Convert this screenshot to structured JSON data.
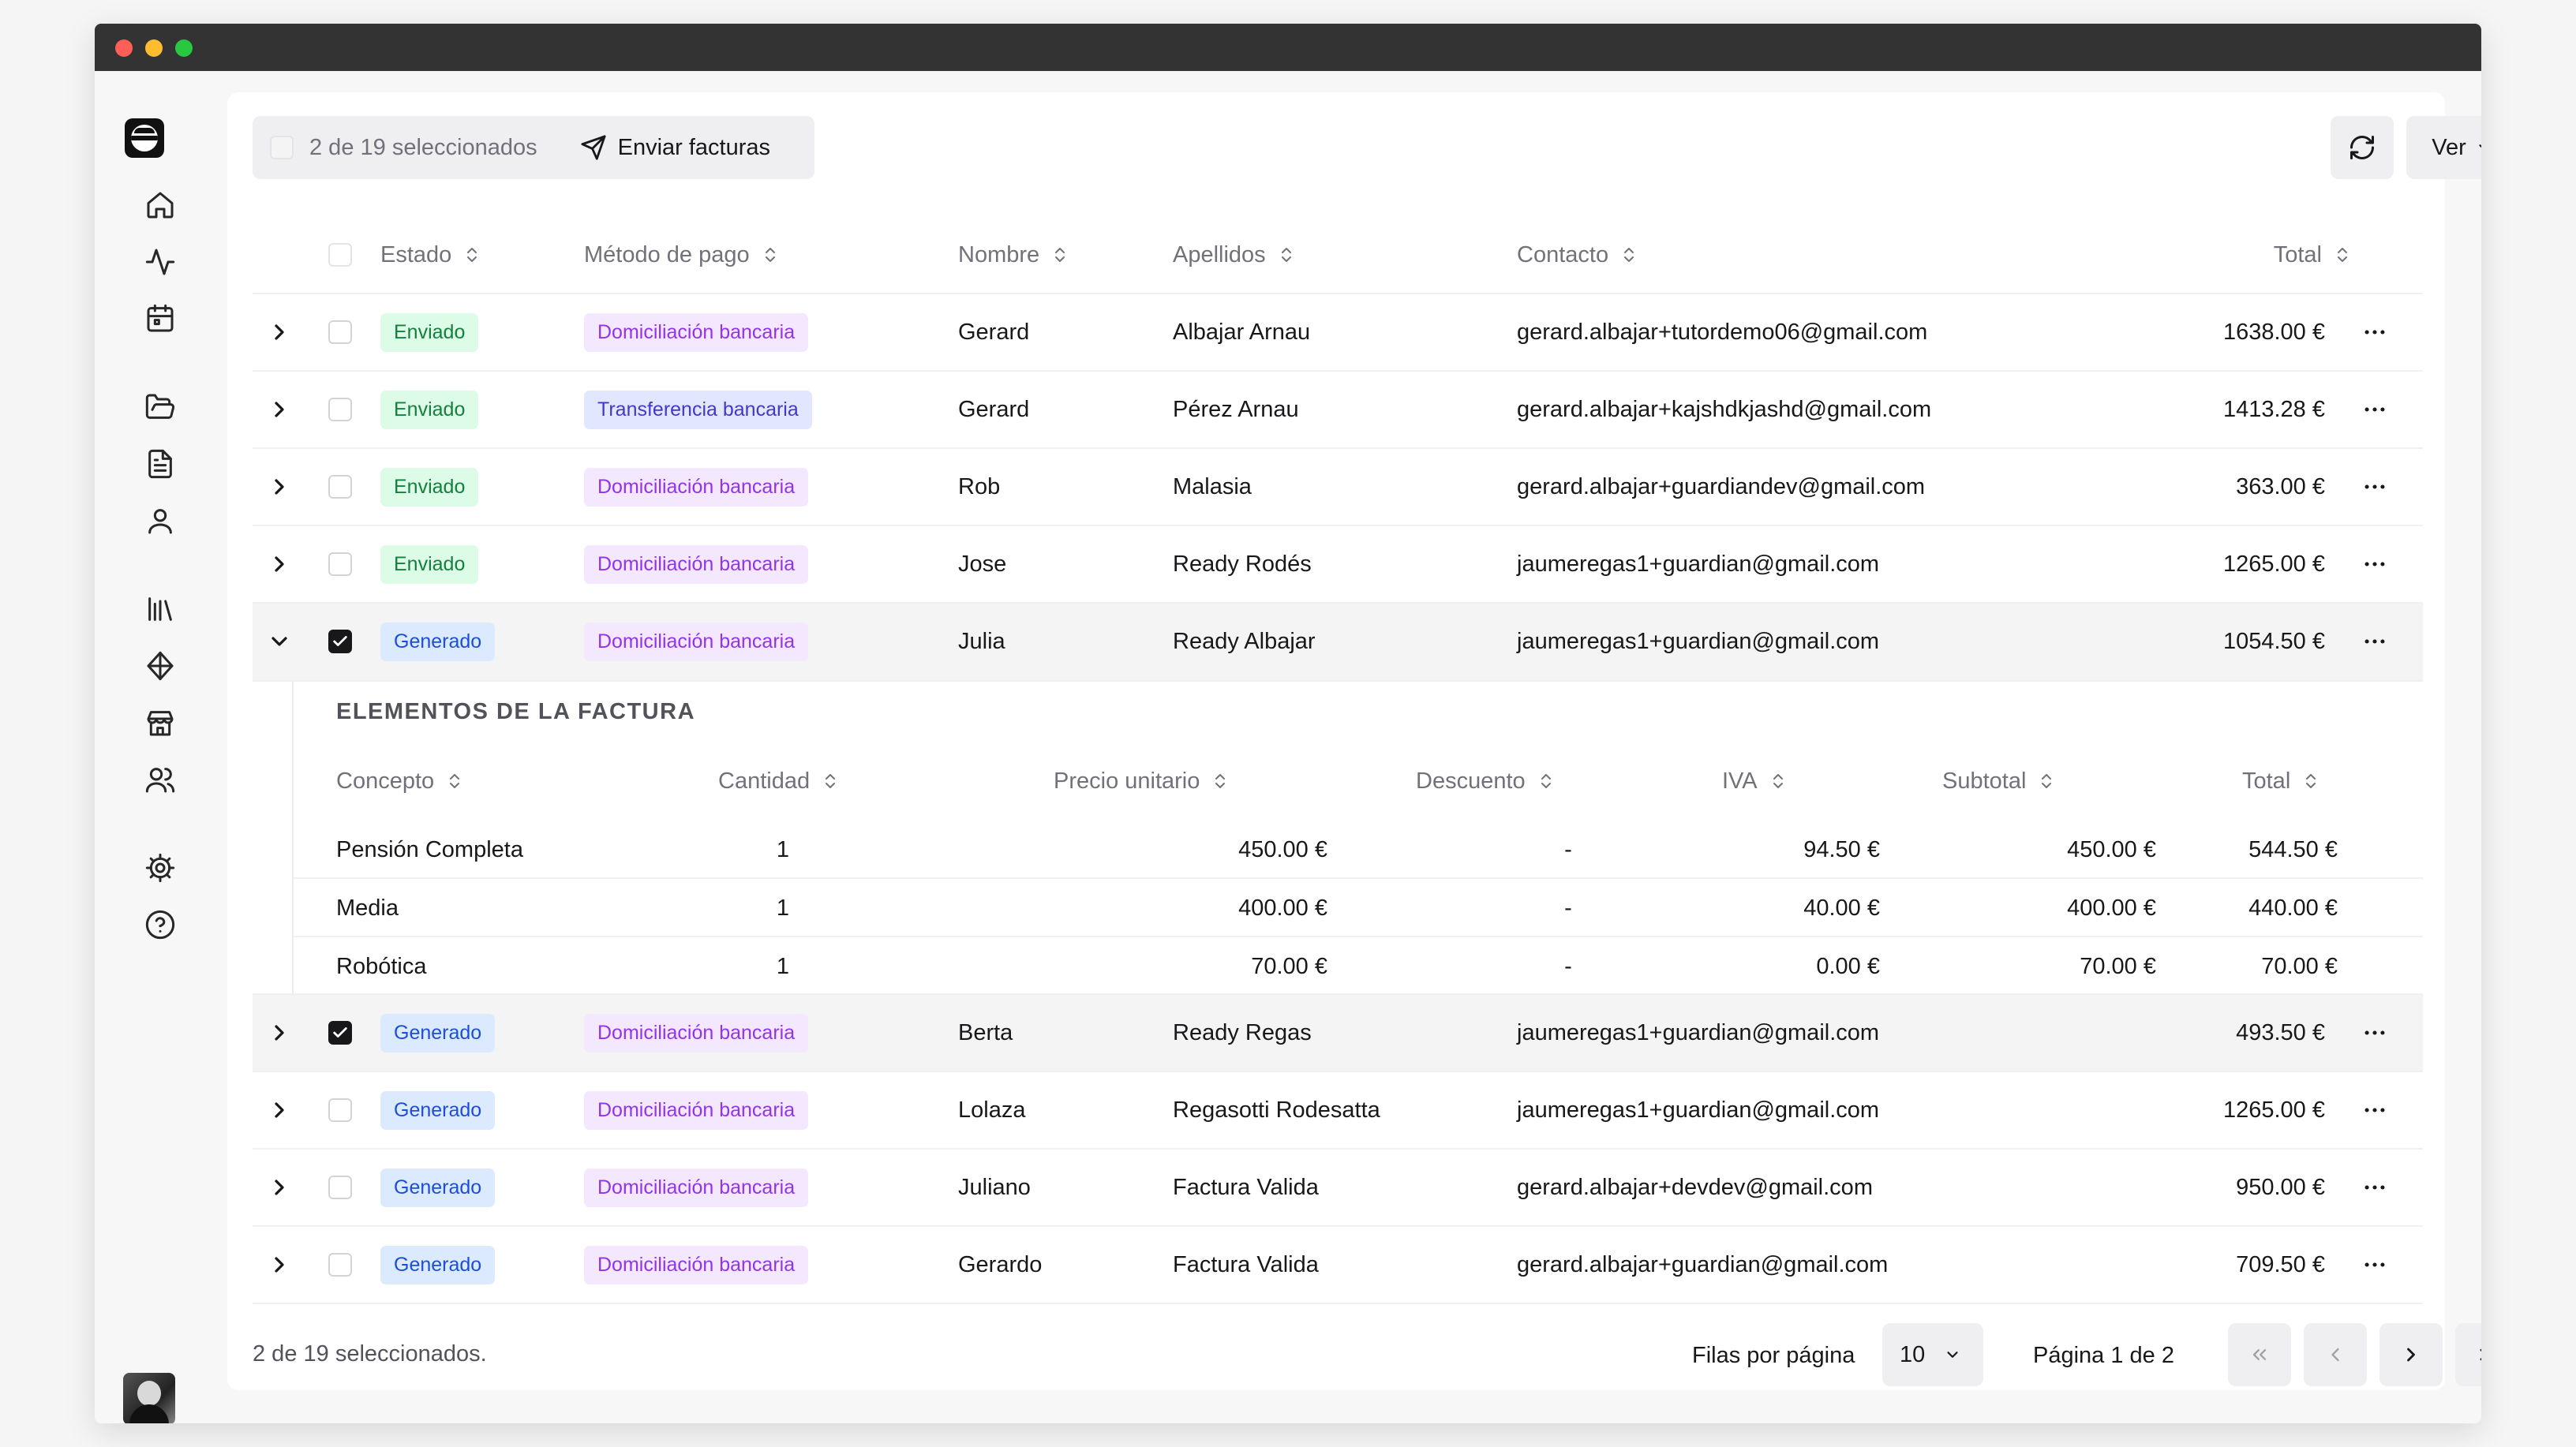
{
  "toolbar": {
    "selection_count": "2 de 19 seleccionados",
    "send_label": "Enviar facturas",
    "view_label": "Ver"
  },
  "table": {
    "headers": {
      "status": "Estado",
      "payment_method": "Método de pago",
      "name": "Nombre",
      "surname": "Apellidos",
      "contact": "Contacto",
      "total": "Total"
    },
    "rows": [
      {
        "status": "Enviado",
        "payment": "Domiciliación bancaria",
        "name": "Gerard",
        "surname": "Albajar Arnau",
        "contact": "gerard.albajar+tutordemo06@gmail.com",
        "total": "1638.00 €"
      },
      {
        "status": "Enviado",
        "payment": "Transferencia bancaria",
        "name": "Gerard",
        "surname": "Pérez Arnau",
        "contact": "gerard.albajar+kajshdkjashd@gmail.com",
        "total": "1413.28 €"
      },
      {
        "status": "Enviado",
        "payment": "Domiciliación bancaria",
        "name": "Rob",
        "surname": "Malasia",
        "contact": "gerard.albajar+guardiandev@gmail.com",
        "total": "363.00 €"
      },
      {
        "status": "Enviado",
        "payment": "Domiciliación bancaria",
        "name": "Jose",
        "surname": "Ready Rodés",
        "contact": "jaumeregas1+guardian@gmail.com",
        "total": "1265.00 €"
      },
      {
        "status": "Generado",
        "payment": "Domiciliación bancaria",
        "name": "Julia",
        "surname": "Ready Albajar",
        "contact": "jaumeregas1+guardian@gmail.com",
        "total": "1054.50 €"
      },
      {
        "status": "Generado",
        "payment": "Domiciliación bancaria",
        "name": "Berta",
        "surname": "Ready Regas",
        "contact": "jaumeregas1+guardian@gmail.com",
        "total": "493.50 €"
      },
      {
        "status": "Generado",
        "payment": "Domiciliación bancaria",
        "name": "Lolaza",
        "surname": "Regasotti Rodesatta",
        "contact": "jaumeregas1+guardian@gmail.com",
        "total": "1265.00 €"
      },
      {
        "status": "Generado",
        "payment": "Domiciliación bancaria",
        "name": "Juliano",
        "surname": "Factura Valida",
        "contact": "gerard.albajar+devdev@gmail.com",
        "total": "950.00 €"
      },
      {
        "status": "Generado",
        "payment": "Domiciliación bancaria",
        "name": "Gerardo",
        "surname": "Factura Valida",
        "contact": "gerard.albajar+guardian@gmail.com",
        "total": "709.50 €"
      }
    ]
  },
  "invoice_items": {
    "title": "ELEMENTOS DE LA FACTURA",
    "headers": {
      "concept": "Concepto",
      "quantity": "Cantidad",
      "unit_price": "Precio unitario",
      "discount": "Descuento",
      "vat": "IVA",
      "subtotal": "Subtotal",
      "total": "Total"
    },
    "items": [
      {
        "concept": "Pensión Completa",
        "quantity": "1",
        "unit_price": "450.00 €",
        "discount": "-",
        "vat": "94.50 €",
        "subtotal": "450.00 €",
        "total": "544.50 €"
      },
      {
        "concept": "Media",
        "quantity": "1",
        "unit_price": "400.00 €",
        "discount": "-",
        "vat": "40.00 €",
        "subtotal": "400.00 €",
        "total": "440.00 €"
      },
      {
        "concept": "Robótica",
        "quantity": "1",
        "unit_price": "70.00 €",
        "discount": "-",
        "vat": "0.00 €",
        "subtotal": "70.00 €",
        "total": "70.00 €"
      }
    ]
  },
  "footer": {
    "selection_text": "2 de 19 seleccionados.",
    "rows_per_page_label": "Filas por página",
    "rows_per_page_value": "10",
    "page_label": "Página 1 de 2"
  },
  "icons": {
    "sidebar": [
      "home-icon",
      "activity-icon",
      "calendar-icon",
      "folder-open-icon",
      "file-text-icon",
      "user-icon",
      "library-icon",
      "layers-icon",
      "store-icon",
      "users-icon",
      "settings-icon",
      "help-circle-icon"
    ]
  },
  "colors": {
    "sent_badge_bg": "#dcfce7",
    "sent_badge_text": "#15803d",
    "generated_badge_bg": "#dbeafe",
    "generated_badge_text": "#1d4ed8",
    "payment_badge_bg": "#f3e8ff",
    "payment_badge_text": "#9333ea"
  }
}
